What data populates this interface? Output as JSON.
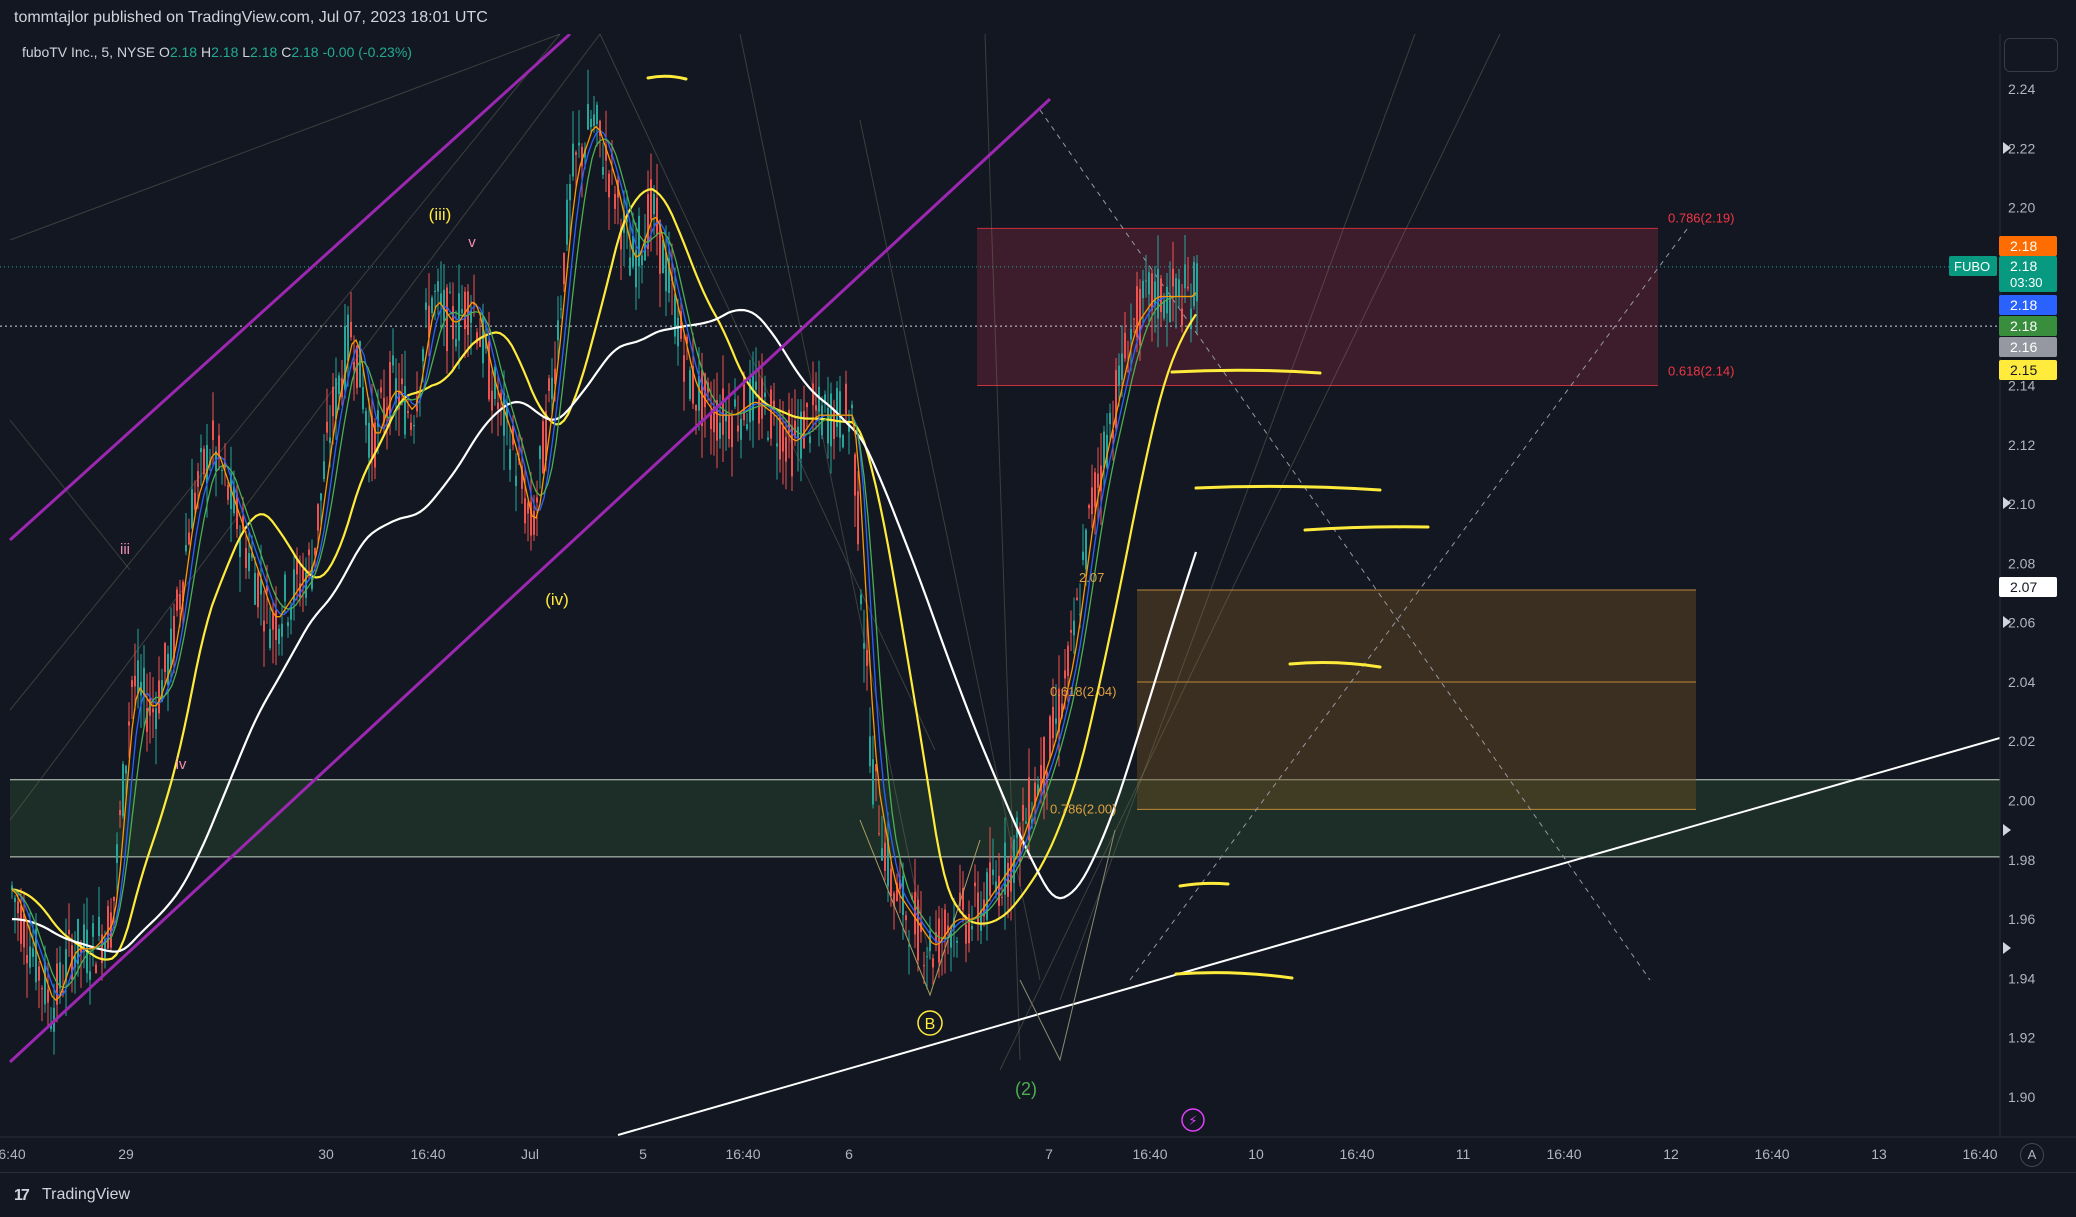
{
  "header": {
    "publisher_line": "tommtajlor published on TradingView.com, Jul 07, 2023 18:01 UTC"
  },
  "legend": {
    "symbol": "fuboTV Inc., 5, NYSE",
    "o_label": "O",
    "o_value": "2.18",
    "h_label": "H",
    "h_value": "2.18",
    "l_label": "L",
    "l_value": "2.18",
    "c_label": "C",
    "c_value": "2.18",
    "change": "-0.00 (-0.23%)"
  },
  "footer": {
    "brand": "TradingView"
  },
  "colors": {
    "background": "#131722",
    "purple": "#9c27b0",
    "yellow": "#ffeb3b",
    "white": "#ffffff",
    "up": "#26a69a",
    "down": "#ef5350",
    "fib_red": "#f23645",
    "fib_orange": "#e0a040",
    "green_zone": "#1e3a2a"
  },
  "chart_data": {
    "type": "candlestick",
    "symbol": "FUBO",
    "interval": "5",
    "exchange": "NYSE",
    "y_axis": {
      "min": 1.89,
      "max": 2.25,
      "ticks": [
        "2.24",
        "2.22",
        "2.20",
        "2.18",
        "2.16",
        "2.14",
        "2.12",
        "2.10",
        "2.08",
        "2.06",
        "2.04",
        "2.02",
        "2.00",
        "1.98",
        "1.96",
        "1.94",
        "1.92",
        "1.90"
      ]
    },
    "x_axis": {
      "ticks": [
        "6:40",
        "29",
        "30",
        "16:40",
        "Jul",
        "5",
        "16:40",
        "6",
        "7",
        "16:40",
        "10",
        "16:40",
        "11",
        "16:40",
        "12",
        "16:40",
        "13",
        "16:40"
      ]
    },
    "price_path": [
      [
        0,
        1.97
      ],
      [
        20,
        1.95
      ],
      [
        40,
        1.93
      ],
      [
        60,
        1.95
      ],
      [
        80,
        1.95
      ],
      [
        100,
        1.96
      ],
      [
        120,
        2.04
      ],
      [
        140,
        2.03
      ],
      [
        160,
        2.05
      ],
      [
        180,
        2.1
      ],
      [
        200,
        2.12
      ],
      [
        220,
        2.1
      ],
      [
        240,
        2.08
      ],
      [
        260,
        2.06
      ],
      [
        280,
        2.07
      ],
      [
        300,
        2.08
      ],
      [
        320,
        2.13
      ],
      [
        340,
        2.16
      ],
      [
        360,
        2.12
      ],
      [
        380,
        2.14
      ],
      [
        400,
        2.13
      ],
      [
        420,
        2.17
      ],
      [
        440,
        2.16
      ],
      [
        460,
        2.17
      ],
      [
        480,
        2.14
      ],
      [
        500,
        2.12
      ],
      [
        520,
        2.09
      ],
      [
        540,
        2.14
      ],
      [
        560,
        2.21
      ],
      [
        580,
        2.23
      ],
      [
        600,
        2.21
      ],
      [
        620,
        2.18
      ],
      [
        640,
        2.2
      ],
      [
        660,
        2.17
      ],
      [
        680,
        2.14
      ],
      [
        700,
        2.13
      ],
      [
        720,
        2.13
      ],
      [
        740,
        2.135
      ],
      [
        760,
        2.13
      ],
      [
        780,
        2.12
      ],
      [
        800,
        2.13
      ],
      [
        820,
        2.13
      ],
      [
        840,
        2.13
      ],
      [
        860,
        2.01
      ],
      [
        880,
        1.97
      ],
      [
        900,
        1.96
      ],
      [
        920,
        1.95
      ],
      [
        940,
        1.96
      ],
      [
        960,
        1.96
      ],
      [
        980,
        1.97
      ],
      [
        1000,
        1.98
      ],
      [
        1020,
        2.0
      ],
      [
        1040,
        2.02
      ],
      [
        1060,
        2.05
      ],
      [
        1080,
        2.1
      ],
      [
        1100,
        2.13
      ],
      [
        1120,
        2.16
      ],
      [
        1140,
        2.17
      ],
      [
        1160,
        2.17
      ],
      [
        1180,
        2.17
      ],
      [
        1190,
        2.18
      ]
    ],
    "moving_averages": [
      {
        "name": "MA yellow",
        "color": "#ffeb3b"
      },
      {
        "name": "MA white",
        "color": "#ffffff"
      },
      {
        "name": "MA blue",
        "color": "#2962ff"
      },
      {
        "name": "MA green",
        "color": "#4caf50"
      },
      {
        "name": "MA orange",
        "color": "#ff9800"
      }
    ],
    "fib_zones": [
      {
        "name": "upper",
        "color": "#f23645",
        "levels": [
          {
            "label": "0.786(2.19)",
            "value": 2.193
          },
          {
            "label": "0.618(2.14)",
            "value": 2.14
          }
        ]
      },
      {
        "name": "lower",
        "color": "#e0a040",
        "levels": [
          {
            "label": "2.07",
            "value": 2.071
          },
          {
            "label": "0.618(2.04)",
            "value": 2.04
          },
          {
            "label": "0.786(2.00)",
            "value": 1.997
          }
        ]
      }
    ],
    "green_zone": {
      "from": 1.981,
      "to": 2.007
    },
    "wave_labels": [
      {
        "text": "(iii)",
        "color": "#ffeb3b"
      },
      {
        "text": "v",
        "color": "#f48fb1"
      },
      {
        "text": "iii",
        "color": "#f48fb1"
      },
      {
        "text": "iv",
        "color": "#f48fb1"
      },
      {
        "text": "(iv)",
        "color": "#ffeb3b"
      },
      {
        "text": "B",
        "color": "#ffeb3b"
      },
      {
        "text": "(2)",
        "color": "#4caf50"
      }
    ],
    "price_scale_labels": [
      {
        "text": "2.18",
        "color": "#ff6d00",
        "value": 2.18
      },
      {
        "text": "2.18",
        "color": "#089981",
        "value": 2.18,
        "tag": "FUBO",
        "countdown": "03:30"
      },
      {
        "text": "2.18",
        "color": "#2962ff",
        "value": 2.18
      },
      {
        "text": "2.18",
        "color": "#388e3c",
        "value": 2.18
      },
      {
        "text": "2.16",
        "color": "#9598a1",
        "value": 2.16
      },
      {
        "text": "2.15",
        "color": "#ffeb3b",
        "value": 2.15
      },
      {
        "text": "2.07",
        "color": "#ffffff",
        "value": 2.07
      }
    ],
    "grid": false
  }
}
